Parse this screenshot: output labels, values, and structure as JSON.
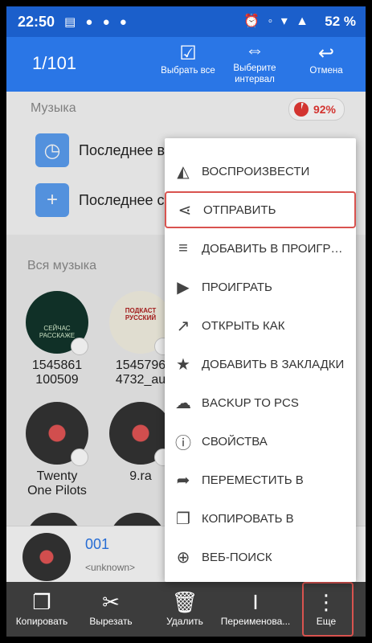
{
  "status": {
    "time": "22:50",
    "battery": "52 %",
    "left_icons": "▤ ● ● ●",
    "right_icons": "⏰ ◦ ▾ ▲"
  },
  "appbar": {
    "counter": "1/101",
    "select_all": "Выбрать все",
    "select_interval": "Выберите интервал",
    "cancel": "Отмена"
  },
  "music_section": {
    "title": "Музыка",
    "storage_percent": "92%",
    "recent": [
      {
        "label": "Последнее в"
      },
      {
        "label": "Последнее с"
      }
    ]
  },
  "all_music": {
    "title": "Вся музыка",
    "items": [
      {
        "line1": "1545861",
        "line2": "100509",
        "badge": "СЕЙЧАС РАССКАЖЕ"
      },
      {
        "line1": "1545796",
        "line2": "4732_au",
        "badge": "ПОДКАСТ РУССКИЙ"
      },
      {
        "line1": "Twenty",
        "line2": "One Pilots"
      },
      {
        "line1": "9.ra",
        "line2": ""
      }
    ]
  },
  "player": {
    "title": "001",
    "artist": "<unknown>"
  },
  "context_menu": {
    "items": [
      {
        "label": "ВОСПРОИЗВЕСТИ",
        "icon": "cast-icon"
      },
      {
        "label": "ОТПРАВИТЬ",
        "icon": "share-icon"
      },
      {
        "label": "ДОБАВИТЬ В ПРОИГРЫВАТЕЛЬ",
        "icon": "playlist-add-icon"
      },
      {
        "label": "ПРОИГРАТЬ",
        "icon": "play-icon"
      },
      {
        "label": "ОТКРЫТЬ КАК",
        "icon": "open-external-icon"
      },
      {
        "label": "ДОБАВИТЬ В ЗАКЛАДКИ",
        "icon": "star-icon"
      },
      {
        "label": "BACKUP TO PCS",
        "icon": "cloud-upload-icon"
      },
      {
        "label": "СВОЙСТВА",
        "icon": "info-icon"
      },
      {
        "label": "ПЕРЕМЕСТИТЬ В",
        "icon": "move-icon"
      },
      {
        "label": "КОПИРОВАТЬ В",
        "icon": "copy-to-icon"
      },
      {
        "label": "ВЕБ-ПОИСК",
        "icon": "web-search-icon"
      }
    ]
  },
  "bottombar": {
    "copy": "Копировать",
    "cut": "Вырезать",
    "delete": "Удалить",
    "rename": "Переименова...",
    "more": "Еще"
  },
  "colors": {
    "primary": "#2a76e6",
    "status": "#1b5fcb",
    "highlight": "#d9534f"
  }
}
